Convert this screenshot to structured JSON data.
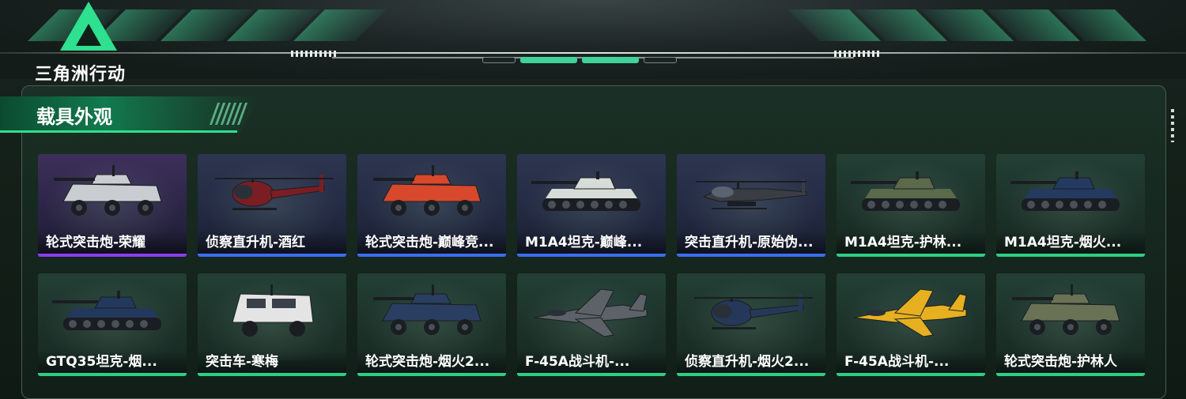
{
  "game": {
    "logo_text": "三角洲行动"
  },
  "section": {
    "title": "载具外观"
  },
  "colors": {
    "accent_green": "#2ee08f",
    "rarity_purple": "#8a3cf0",
    "rarity_blue": "#3a6ef0",
    "rarity_green": "#2ecf84"
  },
  "skins": [
    {
      "label": "轮式突击炮-荣耀",
      "rarity": "purple",
      "vehicle_type": "wheeled-assault-gun",
      "paint": "#c9ccd0"
    },
    {
      "label": "侦察直升机-酒红",
      "rarity": "blue",
      "vehicle_type": "scout-helicopter",
      "paint": "#7a1e24"
    },
    {
      "label": "轮式突击炮-巅峰竞...",
      "rarity": "blue",
      "vehicle_type": "wheeled-assault-gun",
      "paint": "#d8482c"
    },
    {
      "label": "M1A4坦克-巅峰...",
      "rarity": "blue",
      "vehicle_type": "tank",
      "paint": "#d8dcd8"
    },
    {
      "label": "突击直升机-原始伪...",
      "rarity": "blue",
      "vehicle_type": "attack-helicopter",
      "paint": "#3a3e44"
    },
    {
      "label": "M1A4坦克-护林...",
      "rarity": "green",
      "vehicle_type": "tank",
      "paint": "#5a6a4a"
    },
    {
      "label": "M1A4坦克-烟火...",
      "rarity": "green",
      "vehicle_type": "tank",
      "paint": "#243a60"
    },
    {
      "label": "GTQ35坦克-烟...",
      "rarity": "green",
      "vehicle_type": "tank",
      "paint": "#22385c"
    },
    {
      "label": "突击车-寒梅",
      "rarity": "green",
      "vehicle_type": "assault-vehicle",
      "paint": "#e4e4e4"
    },
    {
      "label": "轮式突击炮-烟火2...",
      "rarity": "green",
      "vehicle_type": "wheeled-assault-gun",
      "paint": "#2a3e62"
    },
    {
      "label": "F-45A战斗机-...",
      "rarity": "green",
      "vehicle_type": "fighter-jet",
      "paint": "#5c6268"
    },
    {
      "label": "侦察直升机-烟火2...",
      "rarity": "green",
      "vehicle_type": "scout-helicopter",
      "paint": "#26385a"
    },
    {
      "label": "F-45A战斗机-...",
      "rarity": "green",
      "vehicle_type": "fighter-jet",
      "paint": "#e6b020"
    },
    {
      "label": "轮式突击炮-护林人",
      "rarity": "green",
      "vehicle_type": "wheeled-assault-gun",
      "paint": "#6a7256"
    }
  ]
}
